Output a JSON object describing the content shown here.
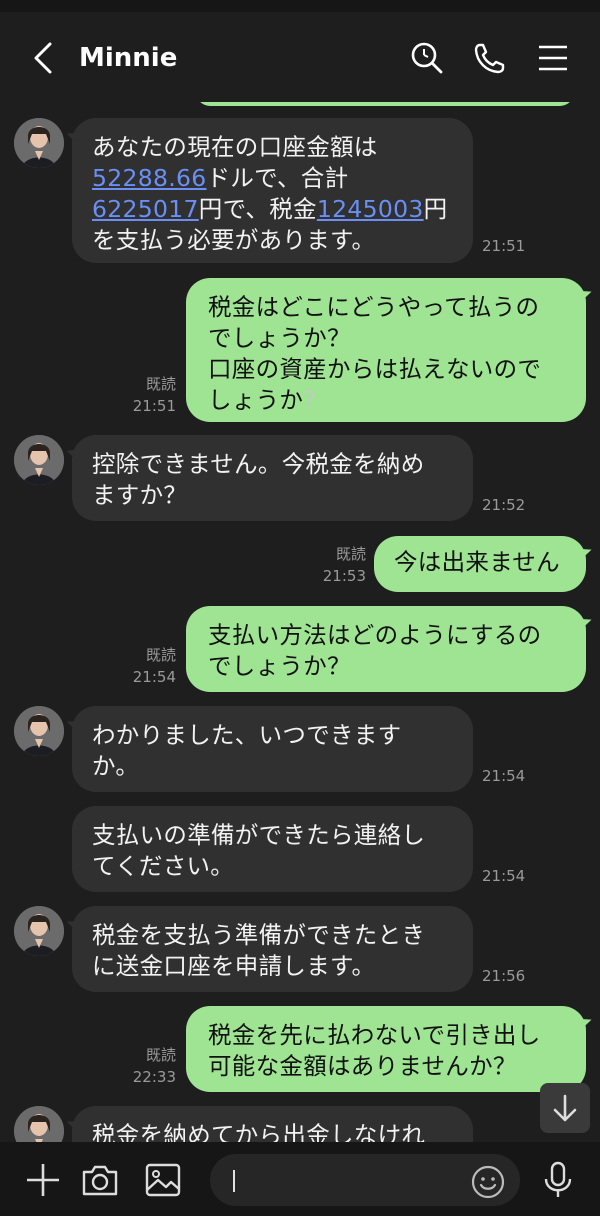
{
  "header": {
    "contact_name": "Minnie",
    "icons": [
      "back-arrow-icon",
      "search-icon",
      "phone-icon",
      "menu-icon"
    ]
  },
  "messages": [
    {
      "from": "contact",
      "line1": "あなたの現在の口座金額は",
      "amount_usd": "52288.66",
      "after_usd": "ドルで、合計",
      "total_yen": "6225017",
      "after_total": "円で、税金",
      "tax_yen": "1245003",
      "after_tax": "円",
      "line4": "を支払う必要があります。",
      "time": "21:51"
    },
    {
      "from": "me",
      "text": "税金はどこにどうやって払うの\nでしょうか？\n口座の資産からは払えないので\nしょうか",
      "qmark": "？",
      "read": "既読",
      "time": "21:51"
    },
    {
      "from": "contact",
      "text": "控除できません。今税金を納め\nますか？",
      "time": "21:52"
    },
    {
      "from": "me",
      "text": "今は出来ません",
      "read": "既読",
      "time": "21:53"
    },
    {
      "from": "me",
      "text": "支払い方法はどのようにするの\nでしょうか？",
      "read": "既読",
      "time": "21:54"
    },
    {
      "from": "contact",
      "text": "わかりました、いつできます\nか。",
      "time": "21:54"
    },
    {
      "from": "contact",
      "text": "支払いの準備ができたら連絡し\nてください。",
      "time": "21:54"
    },
    {
      "from": "contact",
      "text": "税金を支払う準備ができたとき\nに送金口座を申請します。",
      "time": "21:56"
    },
    {
      "from": "me",
      "text": "税金を先に払わないで引き出し\n可能な金額はありませんか？",
      "read": "既読",
      "time": "22:33"
    },
    {
      "from": "contact",
      "text": "税金を納めてから出金しなけれ"
    }
  ],
  "input": {
    "placeholder": "",
    "icons": [
      "plus-icon",
      "camera-icon",
      "image-icon",
      "emoji-icon",
      "microphone-icon"
    ]
  },
  "colors": {
    "background": "#1e1e1e",
    "incoming_bubble": "#303030",
    "outgoing_bubble": "#9ee493",
    "link": "#6a8ff5",
    "meta_text": "#9a9a9a"
  }
}
